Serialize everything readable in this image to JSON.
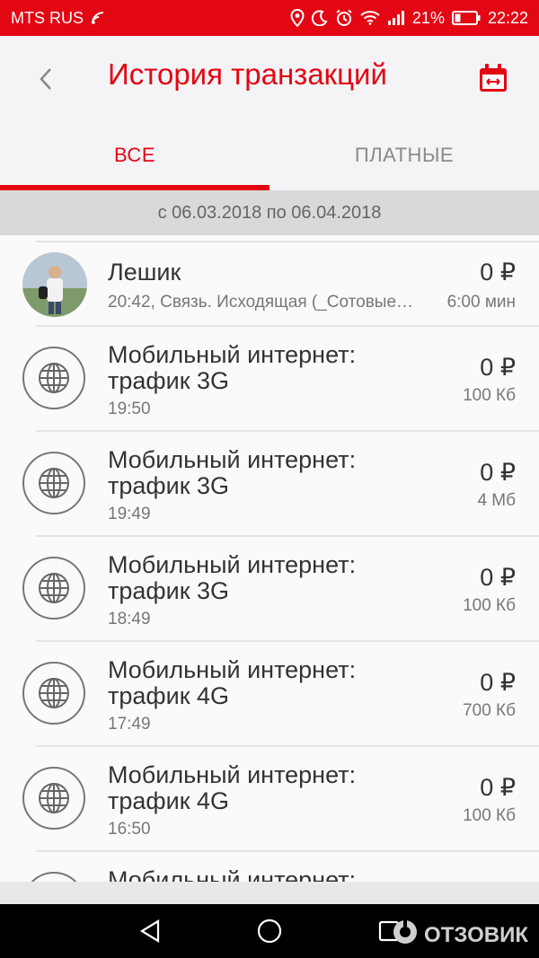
{
  "status": {
    "carrier": "MTS RUS",
    "battery": "21%",
    "time": "22:22",
    "icons": [
      "wifi-signal-icon",
      "location-icon",
      "moon-icon",
      "alarm-icon",
      "wifi-icon",
      "cell-signal-icon",
      "battery-icon"
    ]
  },
  "header": {
    "title": "История транзакций",
    "back_icon": "back-arrow-icon",
    "calendar_icon": "calendar-icon"
  },
  "tabs": [
    {
      "label": "ВСЕ",
      "active": true
    },
    {
      "label": "ПЛАТНЫЕ",
      "active": false
    }
  ],
  "date_range": "с 06.03.2018 по 06.04.2018",
  "transactions": [
    {
      "title1": "Лешик",
      "title2": "",
      "subtitle": "20:42, Связь. Исходящая (_Сотовые…",
      "amount": "0 ₽",
      "unit": "6:00 мин",
      "icon": "avatar"
    },
    {
      "title1": "Мобильный интернет:",
      "title2": "трафик 3G",
      "subtitle": "19:50",
      "amount": "0 ₽",
      "unit": "100 Кб",
      "icon": "globe-icon"
    },
    {
      "title1": "Мобильный интернет:",
      "title2": "трафик 3G",
      "subtitle": "19:49",
      "amount": "0 ₽",
      "unit": "4 Мб",
      "icon": "globe-icon"
    },
    {
      "title1": "Мобильный интернет:",
      "title2": "трафик 3G",
      "subtitle": "18:49",
      "amount": "0 ₽",
      "unit": "100 Кб",
      "icon": "globe-icon"
    },
    {
      "title1": "Мобильный интернет:",
      "title2": "трафик 4G",
      "subtitle": "17:49",
      "amount": "0 ₽",
      "unit": "700 Кб",
      "icon": "globe-icon"
    },
    {
      "title1": "Мобильный интернет:",
      "title2": "трафик 4G",
      "subtitle": "16:50",
      "amount": "0 ₽",
      "unit": "100 Кб",
      "icon": "globe-icon"
    },
    {
      "title1": "Мобильный интернет:",
      "title2": "",
      "subtitle": "",
      "amount": "",
      "unit": "",
      "icon": "globe-icon"
    }
  ],
  "navbar": {
    "icons": [
      "nav-back-icon",
      "nav-home-icon",
      "nav-recents-icon"
    ],
    "watermark": "ОТЗОВИК"
  },
  "colors": {
    "accent": "#e30613",
    "text": "#333333",
    "muted": "#777777",
    "divider_bar": "#d9d9d9"
  }
}
